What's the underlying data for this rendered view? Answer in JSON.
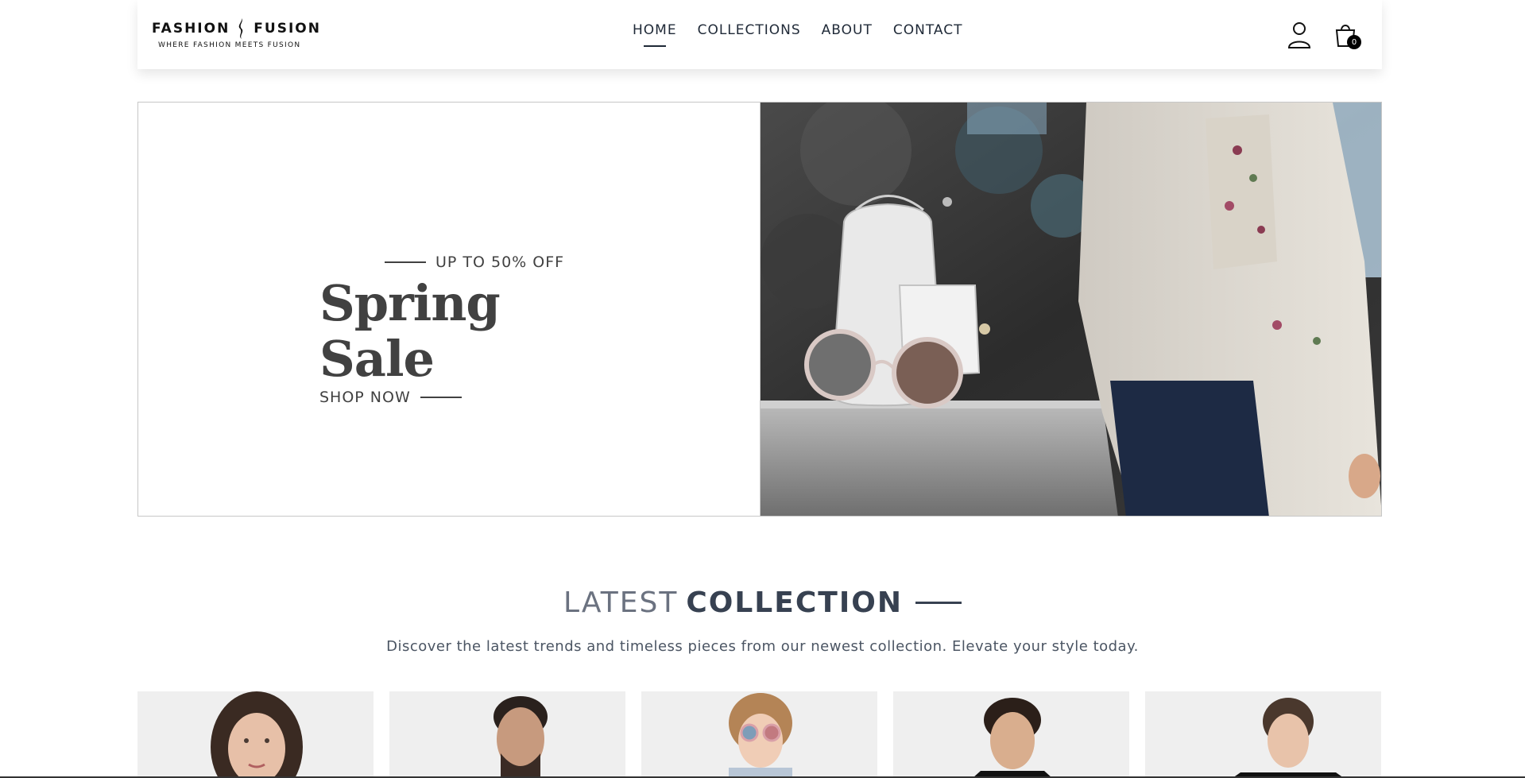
{
  "brand": {
    "name_left": "FASHION",
    "name_right": "FUSION",
    "tagline": "WHERE FASHION MEETS FUSION"
  },
  "nav": {
    "items": [
      {
        "label": "HOME",
        "active": true
      },
      {
        "label": "COLLECTIONS",
        "active": false
      },
      {
        "label": "ABOUT",
        "active": false
      },
      {
        "label": "CONTACT",
        "active": false
      }
    ]
  },
  "header_icons": {
    "profile_icon": "user-icon",
    "cart_icon": "shopping-bag-icon",
    "cart_count": "0"
  },
  "hero": {
    "tag": "UP TO 50% OFF",
    "title": "Spring Sale",
    "cta": "SHOP NOW"
  },
  "latest": {
    "title_light": "LATEST",
    "title_bold": "COLLECTION",
    "subtitle": "Discover the latest trends and timeless pieces from our newest collection. Elevate your style today."
  },
  "products": [
    {
      "name": "product-1"
    },
    {
      "name": "product-2"
    },
    {
      "name": "product-3"
    },
    {
      "name": "product-4"
    },
    {
      "name": "product-5"
    }
  ],
  "colors": {
    "text_dark": "#1f2937",
    "text_gray": "#6b7280",
    "hero_text": "#414141",
    "card_bg": "#efefef"
  }
}
